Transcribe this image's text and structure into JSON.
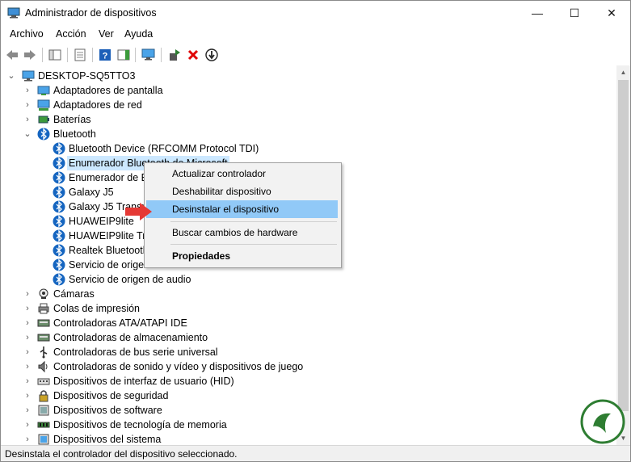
{
  "window": {
    "title": "Administrador de dispositivos"
  },
  "menu": [
    "Archivo",
    "Acción",
    "Ver",
    "Ayuda"
  ],
  "tree": {
    "root": "DESKTOP-SQ5TTO3",
    "categories_top": [
      "Adaptadores de pantalla",
      "Adaptadores de red",
      "Baterías"
    ],
    "bluetooth": {
      "label": "Bluetooth",
      "children": [
        "Bluetooth Device (RFCOMM Protocol TDI)",
        "Enumerador Bluetooth de Microsoft",
        "Enumerador de Bl",
        "Galaxy J5",
        "Galaxy J5 Transpo",
        "HUAWEIP9lite",
        "HUAWEIP9lite Tran",
        "Realtek Bluetooth",
        "Servicio de origen de audio",
        "Servicio de origen de audio"
      ]
    },
    "categories_bottom": [
      "Cámaras",
      "Colas de impresión",
      "Controladoras ATA/ATAPI IDE",
      "Controladoras de almacenamiento",
      "Controladoras de bus serie universal",
      "Controladoras de sonido y vídeo y dispositivos de juego",
      "Dispositivos de interfaz de usuario (HID)",
      "Dispositivos de seguridad",
      "Dispositivos de software",
      "Dispositivos de tecnología de memoria",
      "Dispositivos del sistema"
    ]
  },
  "context_menu": {
    "items": [
      "Actualizar controlador",
      "Deshabilitar dispositivo",
      "Desinstalar el dispositivo",
      "Buscar cambios de hardware",
      "Propiedades"
    ],
    "highlighted": "Desinstalar el dispositivo"
  },
  "status": "Desinstala el controlador del dispositivo seleccionado.",
  "colors": {
    "selection": "#cce8ff",
    "menu_highlight": "#91c9f7",
    "bluetooth": "#1565c0",
    "arrow": "#e53935",
    "toolbar_green": "#2e7d32",
    "toolbar_red": "#e00000"
  },
  "icons": {
    "app": "device-manager-icon",
    "root": "computer-icon",
    "bluetooth": "bluetooth-icon",
    "uninstall": "red-x-icon"
  }
}
